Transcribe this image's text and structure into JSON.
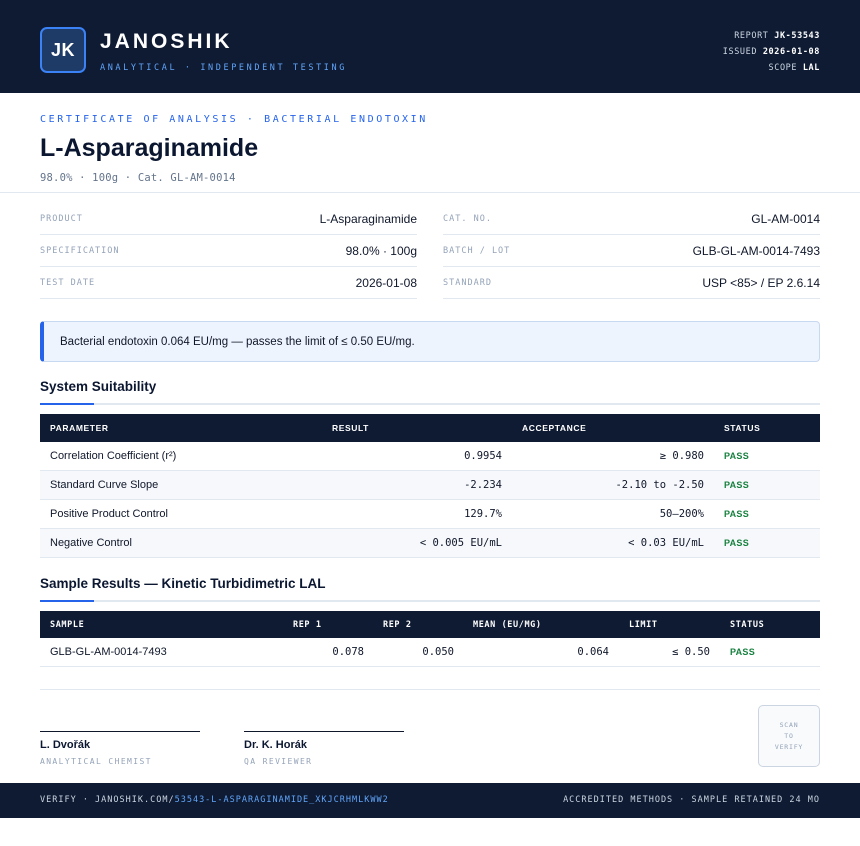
{
  "header": {
    "logo": "JK",
    "brand": "JANOSHIK",
    "tagline": "ANALYTICAL · INDEPENDENT TESTING",
    "report_label": "REPORT",
    "report_value": "JK-53543",
    "issued_label": "ISSUED",
    "issued_value": "2026-01-08",
    "scope_label": "SCOPE",
    "scope_value": "LAL"
  },
  "doc": {
    "eyebrow": "CERTIFICATE OF ANALYSIS · BACTERIAL ENDOTOXIN",
    "title": "L-Asparaginamide",
    "subline": "98.0% · 100g  ·  Cat. GL-AM-0014"
  },
  "info": {
    "left": [
      {
        "label": "PRODUCT",
        "value": "L-Asparaginamide"
      },
      {
        "label": "SPECIFICATION",
        "value": "98.0% · 100g"
      },
      {
        "label": "TEST DATE",
        "value": "2026-01-08"
      }
    ],
    "right": [
      {
        "label": "CAT. NO.",
        "value": "GL-AM-0014"
      },
      {
        "label": "BATCH / LOT",
        "value": "GLB-GL-AM-0014-7493"
      },
      {
        "label": "STANDARD",
        "value": "USP <85> / EP 2.6.14"
      }
    ]
  },
  "callout": "Bacterial endotoxin 0.064 EU/mg — passes the limit of ≤ 0.50 EU/mg.",
  "system_suitability": {
    "title": "System Suitability",
    "headers": [
      "PARAMETER",
      "RESULT",
      "ACCEPTANCE",
      "STATUS"
    ],
    "rows": [
      {
        "parameter": "Correlation Coefficient (r²)",
        "result": "0.9954",
        "acceptance": "≥ 0.980",
        "status": "PASS"
      },
      {
        "parameter": "Standard Curve Slope",
        "result": "-2.234",
        "acceptance": "-2.10 to -2.50",
        "status": "PASS"
      },
      {
        "parameter": "Positive Product Control",
        "result": "129.7%",
        "acceptance": "50–200%",
        "status": "PASS"
      },
      {
        "parameter": "Negative Control",
        "result": "< 0.005 EU/mL",
        "acceptance": "< 0.03 EU/mL",
        "status": "PASS"
      }
    ]
  },
  "sample_results": {
    "title": "Sample Results — Kinetic Turbidimetric LAL",
    "headers": [
      "SAMPLE",
      "REP 1",
      "REP 2",
      "MEAN (EU/MG)",
      "LIMIT",
      "STATUS"
    ],
    "rows": [
      {
        "sample": "GLB-GL-AM-0014-7493",
        "rep1": "0.078",
        "rep2": "0.050",
        "mean": "0.064",
        "limit": "≤ 0.50",
        "status": "PASS"
      }
    ]
  },
  "signatures": [
    {
      "name": "L. Dvořák",
      "role": "ANALYTICAL CHEMIST"
    },
    {
      "name": "Dr. K. Horák",
      "role": "QA REVIEWER"
    }
  ],
  "qr": {
    "line1": "SCAN",
    "line2": "TO",
    "line3": "VERIFY"
  },
  "footer": {
    "verify_prefix": "VERIFY · JANOSHIK.COM/",
    "verify_link": "53543-L-ASPARAGINAMIDE_XKJCRHMLKWW2",
    "right": "ACCREDITED METHODS · SAMPLE RETAINED 24 MO"
  },
  "colors": {
    "navy": "#0f1b33",
    "accent": "#2563eb",
    "pass": "#15803d"
  }
}
